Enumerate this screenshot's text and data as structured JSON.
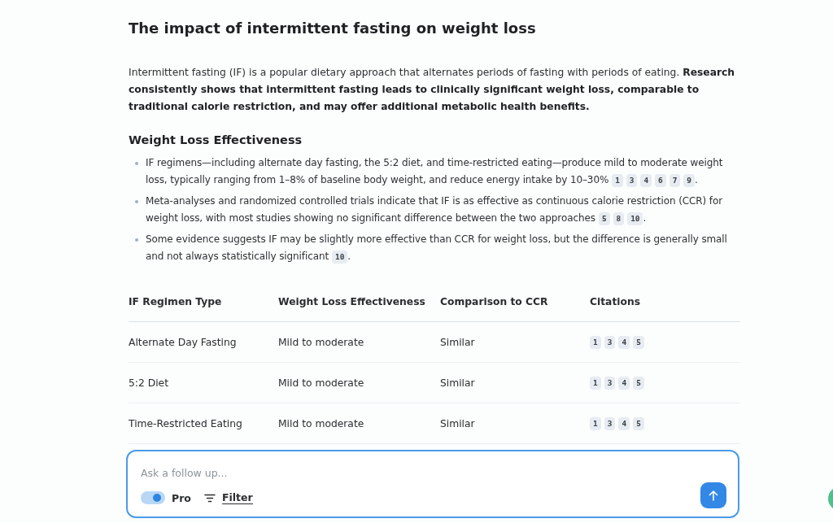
{
  "title": "The impact of intermittent fasting on weight loss",
  "intro": "Intermittent fasting (IF) is a popular dietary approach that alternates periods of fasting with periods of eating. **Research consistently shows that intermittent fasting leads to clinically significant weight loss, comparable to traditional calorie restriction, and may offer additional metabolic health benefits.**",
  "section_heading": "Weight Loss Effectiveness",
  "bullets": [
    {
      "text": "IF regimens—including alternate day fasting, the 5:2 diet, and time-restricted eating—produce mild to moderate weight loss, typically ranging from 1–8% of baseline body weight, and reduce energy intake by 10–30%",
      "citations": [
        "1",
        "3",
        "4",
        "6",
        "7",
        "9"
      ],
      "end": "."
    },
    {
      "text": "Meta-analyses and randomized controlled trials indicate that IF is as effective as continuous calorie restriction (CCR) for weight loss, with most studies showing no significant difference between the two approaches",
      "citations": [
        "5",
        "8",
        "10"
      ],
      "end": "."
    },
    {
      "text": "Some evidence suggests IF may be slightly more effective than CCR for weight loss, but the difference is generally small and not always statistically significant",
      "citations": [
        "10"
      ],
      "end": "."
    }
  ],
  "table": {
    "columns": [
      "IF Regimen Type",
      "Weight Loss Effectiveness",
      "Comparison to CCR",
      "Citations"
    ],
    "rows": [
      {
        "cells": [
          "Alternate Day Fasting",
          "Mild to moderate",
          "Similar"
        ],
        "citations": [
          "1",
          "3",
          "4",
          "5"
        ]
      },
      {
        "cells": [
          "5:2 Diet",
          "Mild to moderate",
          "Similar"
        ],
        "citations": [
          "1",
          "3",
          "4",
          "5"
        ]
      },
      {
        "cells": [
          "Time-Restricted Eating",
          "Mild to moderate",
          "Similar"
        ],
        "citations": [
          "1",
          "3",
          "4",
          "5"
        ]
      }
    ]
  },
  "composer": {
    "placeholder": "Ask a follow up...",
    "pro_toggle": {
      "label": "Pro",
      "on": true
    },
    "filter": "Filter"
  }
}
